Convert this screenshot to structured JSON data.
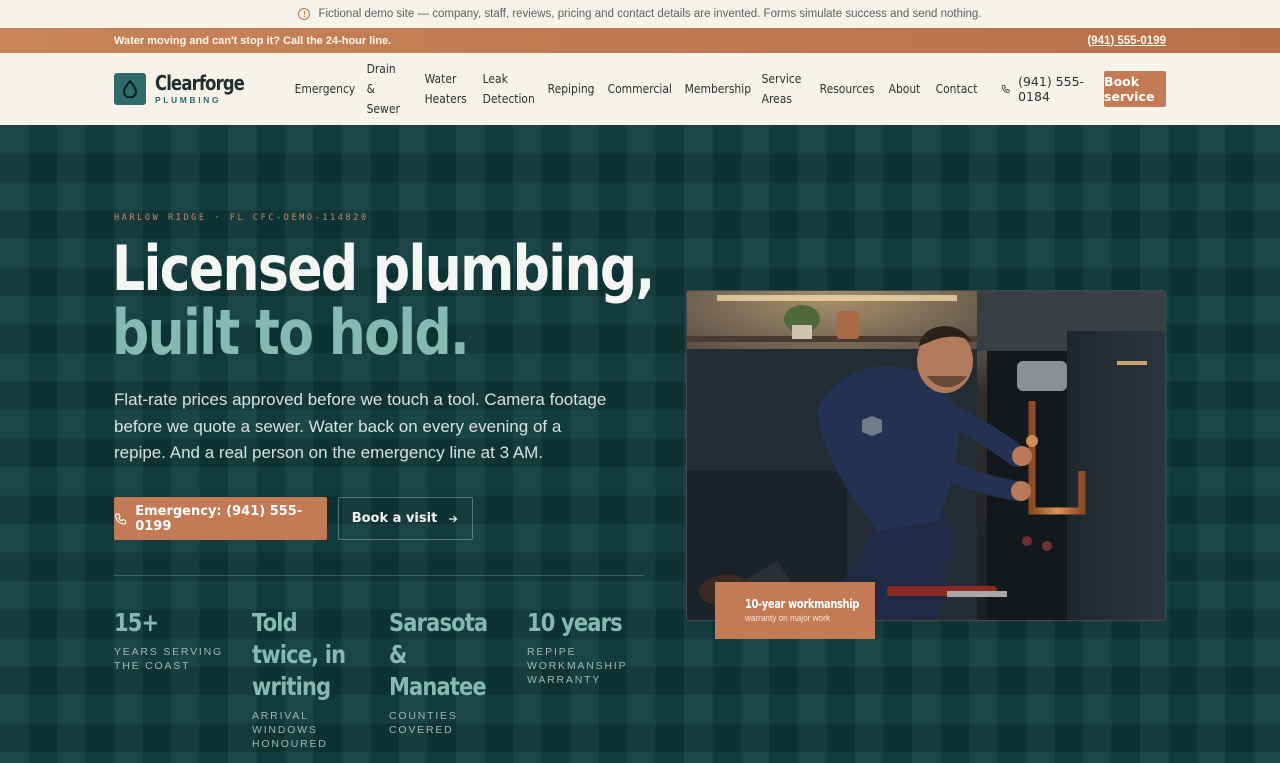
{
  "demo_notice": {
    "icon": "info-icon",
    "text": "Fictional demo site — company, staff, reviews, pricing and contact details are invented. Forms simulate success and send nothing."
  },
  "alert": {
    "message": "Water moving and can't stop it? Call the 24-hour line.",
    "phone": "(941) 555-0199"
  },
  "brand": {
    "name": "Clearforge",
    "tagline": "PLUMBING"
  },
  "nav": [
    {
      "label": "Emergency"
    },
    {
      "label": "Drain & Sewer"
    },
    {
      "label": "Water Heaters"
    },
    {
      "label": "Leak Detection"
    },
    {
      "label": "Repiping"
    },
    {
      "label": "Commercial"
    },
    {
      "label": "Membership"
    },
    {
      "label": "Service Areas"
    },
    {
      "label": "Resources"
    },
    {
      "label": "About"
    },
    {
      "label": "Contact"
    }
  ],
  "header": {
    "phone": "(941) 555-0184",
    "book_label": "Book service"
  },
  "hero": {
    "eyebrow": "HARLOW RIDGE · FL CFC-DEMO-114820",
    "headline_line1": "Licensed plumbing,",
    "headline_line2": "built to hold.",
    "lede": "Flat-rate prices approved before we touch a tool. Camera footage before we quote a sewer. Water back on every evening of a repipe. And a real person on the emergency line at 3 AM.",
    "emergency_button": "Emergency: (941) 555-0199",
    "visit_button": "Book a visit"
  },
  "stats": [
    {
      "value": "15+",
      "label": "YEARS SERVING THE COAST"
    },
    {
      "value": "Told twice, in writing",
      "label": "ARRIVAL WINDOWS HONOURED"
    },
    {
      "value": "Sarasota & Manatee",
      "label": "COUNTIES COVERED"
    },
    {
      "value": "10 years",
      "label": "REPIPE WORKMANSHIP WARRANTY"
    }
  ],
  "badge": {
    "icon": "shield-check-icon",
    "title": "10-year workmanship",
    "subtitle": "warranty on major work"
  },
  "colors": {
    "accent": "#c37a55",
    "hero_bg": "#0f3a3c",
    "teal_text": "#86b9b4",
    "cream": "#f7f2ea"
  }
}
